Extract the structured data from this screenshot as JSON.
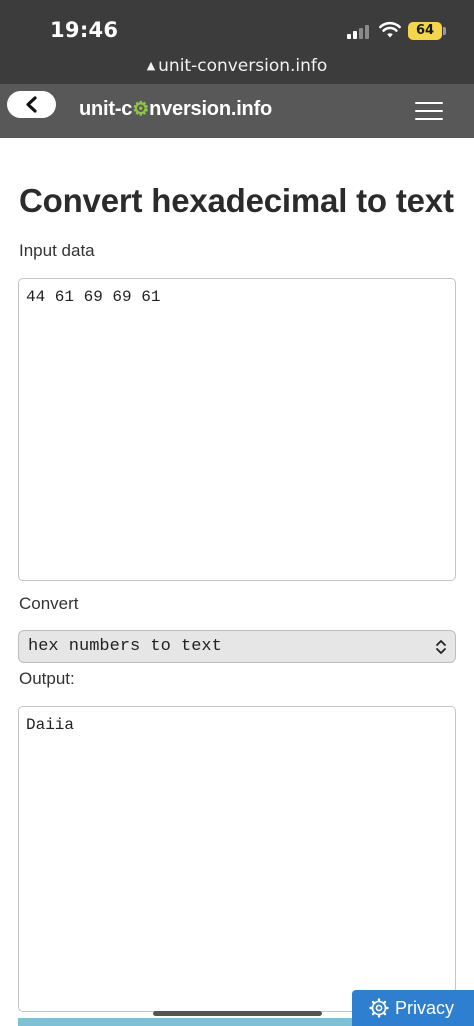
{
  "status_bar": {
    "time": "19:46",
    "battery_level": "64",
    "url": "unit-conversion.info"
  },
  "header": {
    "logo_prefix": "unit-c",
    "logo_gear": "⚙",
    "logo_suffix": "nversion.info",
    "logo_accent_color": "#8dc63f"
  },
  "main": {
    "title": "Convert hexadecimal to text",
    "input_label": "Input data",
    "input_value": "44 61 69 69 61",
    "convert_label": "Convert",
    "convert_selected": "hex numbers to text",
    "output_label": "Output:",
    "output_value": "Daiia"
  },
  "footer": {
    "privacy_label": "Privacy"
  },
  "icons": [
    "back-chevron-icon",
    "hamburger-menu-icon",
    "gear-icon",
    "chevron-updown-icon",
    "signal-icon",
    "wifi-icon",
    "lock-icon"
  ]
}
